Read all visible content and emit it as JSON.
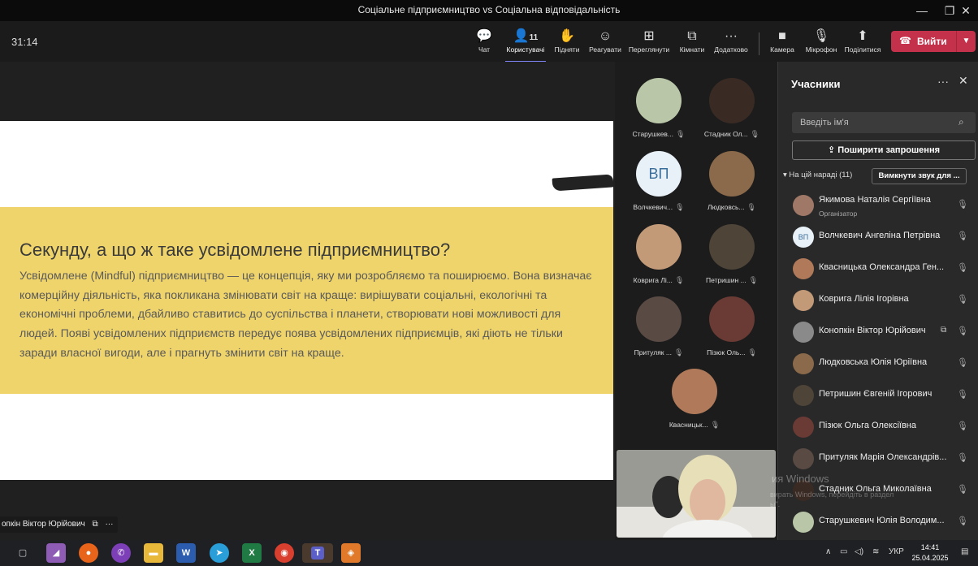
{
  "window": {
    "title": "Соціальне підприємництво vs Соціальна відповідальність",
    "min": "—",
    "restore": "❐",
    "close": "✕"
  },
  "toolbar": {
    "timer": "31:14",
    "chat": "Чат",
    "people": "Користувачі",
    "people_count": "11",
    "raise": "Підняти",
    "react": "Реагувати",
    "view": "Переглянути",
    "rooms": "Кімнати",
    "more": "Додатково",
    "camera": "Камера",
    "mic": "Мікрофон",
    "share": "Поділитися",
    "leave": "Вийти"
  },
  "slide": {
    "title": "Секунду, а що ж таке усвідомлене підприємництво?",
    "body": "Усвідомлене (Mindful) підприємництво — це концепція, яку ми розробляємо та поширюємо. Вона визначає комерційну діяльність, яка покликана змінювати світ на краще: вирішувати соціальні, екологічні та економічні проблеми, дбайливо ставитись до суспільства і планети, створювати нові можливості для людей. Появі усвідомлених підприємств передує поява усвідомлених підприємців, які діють не тільки заради власної вигоди, але і прагнуть змінити світ на краще."
  },
  "presenter_tag": "опкін Віктор Юрійович",
  "gallery": [
    {
      "name": "Старушкев...",
      "color": "#b9c7a8"
    },
    {
      "name": "Стадник Ол...",
      "color": "#3a2a24"
    },
    {
      "name": "Волчкевич...",
      "initials": "ВП"
    },
    {
      "name": "Людковсь...",
      "color": "#8a6a4a"
    },
    {
      "name": "Коврига Лі...",
      "color": "#c29a78"
    },
    {
      "name": "Петришин ...",
      "color": "#4e4438"
    },
    {
      "name": "Притуляк ...",
      "color": "#5a4a44"
    },
    {
      "name": "Пізюк Оль...",
      "color": "#6a3a34"
    },
    {
      "name": "Квасницьк...",
      "color": "#b07a5a"
    }
  ],
  "panel": {
    "title": "Учасники",
    "search_placeholder": "Введіть ім'я",
    "share_invite": "Поширити запрошення",
    "section": "На цій нараді (11)",
    "mute_all": "Вимкнути звук для ...",
    "participants": [
      {
        "name": "Якимова Наталія Сергіївна",
        "role": "Організатор",
        "color": "#a07868"
      },
      {
        "name": "Волчкевич Ангеліна Петрівна",
        "initials": "ВП"
      },
      {
        "name": "Квасницька Олександра Ген...",
        "color": "#b07a5a"
      },
      {
        "name": "Коврига Лілія Ігорівна",
        "color": "#c29a78"
      },
      {
        "name": "Конопкін Віктор Юрійович",
        "color": "#8a8a8a"
      },
      {
        "name": "Людковська Юлія Юріївна",
        "color": "#8a6a4a"
      },
      {
        "name": "Петришин Євгеній Ігорович",
        "color": "#4e4438"
      },
      {
        "name": "Пізюк Ольга Олексіївна",
        "color": "#6a3a34"
      },
      {
        "name": "Притуляк Марія Олександрів...",
        "color": "#5a4a44"
      },
      {
        "name": "Стадник Ольга Миколаївна",
        "color": "#3a2a24"
      },
      {
        "name": "Старушкевич Юлія Володим...",
        "color": "#b9c7a8"
      }
    ]
  },
  "watermark": {
    "line1": "ия Windows",
    "line2": "вирать Windows, перейдіть в раздел",
    "line3": "ы\"."
  },
  "taskbar": {
    "lang": "УКР",
    "time": "14:41",
    "date": "25.04.2025"
  }
}
